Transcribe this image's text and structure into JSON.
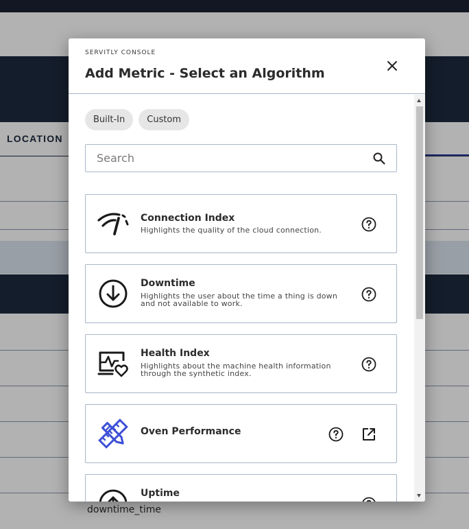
{
  "background": {
    "table_header": "LOCATION",
    "cell_text": "downtime_time"
  },
  "modal": {
    "eyebrow": "SERVITLY CONSOLE",
    "title": "Add Metric - Select an Algorithm",
    "close_icon": "close-icon",
    "filters": [
      {
        "label": "Built-In"
      },
      {
        "label": "Custom"
      }
    ],
    "search": {
      "placeholder": "Search",
      "value": "",
      "icon": "search-icon"
    },
    "algorithms": [
      {
        "title": "Connection Index",
        "description": "Highlights the quality of the cloud connection.",
        "icon": "signal-icon",
        "actions": [
          "help-icon"
        ]
      },
      {
        "title": "Downtime",
        "description": "Highlights the user about the time a thing is down and not available to work.",
        "icon": "arrow-down-circle-icon",
        "actions": [
          "help-icon"
        ]
      },
      {
        "title": "Health Index",
        "description": "Highlights about the machine health information through the synthetic index.",
        "icon": "health-monitor-icon",
        "actions": [
          "help-icon"
        ]
      },
      {
        "title": "Oven Performance",
        "description": "",
        "icon": "ruler-pencil-icon",
        "actions": [
          "help-icon",
          "open-external-icon"
        ]
      },
      {
        "title": "Uptime",
        "description": "",
        "icon": "arrow-up-circle-icon",
        "actions": [
          "help-icon"
        ]
      }
    ]
  },
  "colors": {
    "brand_dark": "#1e2a3e",
    "accent_blue": "#3d4fd6",
    "text": "#2b2b2b",
    "border": "#a8b4c4"
  }
}
